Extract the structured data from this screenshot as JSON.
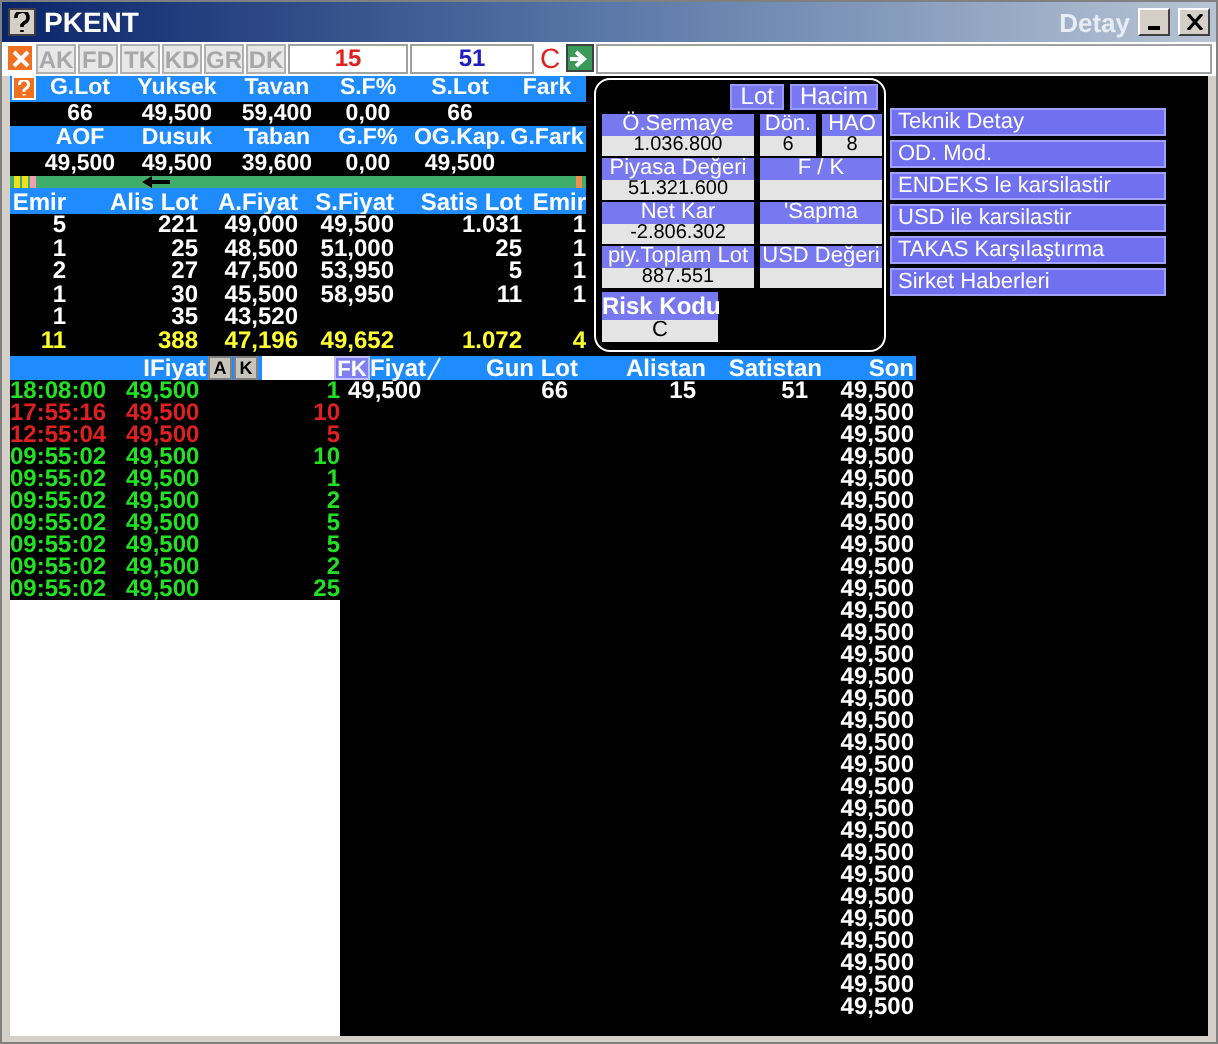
{
  "window": {
    "title": "PKENT",
    "detail_title": "Detay"
  },
  "toolbar": {
    "tabs": [
      "AK",
      "FD",
      "TK",
      "KD",
      "GR",
      "DK"
    ],
    "buy_count": "15",
    "sell_count": "51",
    "risk_letter": "C"
  },
  "summary": [
    {
      "kind": "header",
      "cells": [
        "G.Lot",
        "Yuksek",
        "Tavan",
        "S.F%",
        "S.Lot",
        "Fark"
      ]
    },
    {
      "kind": "values",
      "cells": [
        "66",
        "49,500",
        "59,400",
        "0,00",
        "66",
        ""
      ]
    },
    {
      "kind": "header",
      "cells": [
        "AOF",
        "Dusuk",
        "Taban",
        "G.F%",
        "OG.Kap.",
        "G.Fark"
      ]
    },
    {
      "kind": "values",
      "cells": [
        "49,500",
        "49,500",
        "39,600",
        "0,00",
        "49,500",
        ""
      ]
    }
  ],
  "order_book": {
    "columns": [
      "Emir",
      "Alis Lot",
      "A.Fiyat",
      "S.Fiyat",
      "Satis Lot",
      "Emir"
    ],
    "rows": [
      [
        "5",
        "221",
        "49,000",
        "49,500",
        "1.031",
        "1"
      ],
      [
        "1",
        "25",
        "48,500",
        "51,000",
        "25",
        "1"
      ],
      [
        "2",
        "27",
        "47,500",
        "53,950",
        "5",
        "1"
      ],
      [
        "1",
        "30",
        "45,500",
        "58,950",
        "11",
        "1"
      ],
      [
        "1",
        "35",
        "43,520",
        "",
        "",
        ""
      ]
    ],
    "totals": [
      "11",
      "388",
      "47,196",
      "49,652",
      "1.072",
      "4"
    ]
  },
  "detail": {
    "toggles": [
      "Lot",
      "Hacim"
    ],
    "rows": [
      [
        {
          "label": "Ö.Sermaye",
          "value": "1.036.800"
        },
        {
          "label": "Dön.",
          "value": "6"
        },
        {
          "label": "HAO",
          "value": "8"
        }
      ],
      [
        {
          "label": "Piyasa Değeri",
          "value": "51.321.600"
        },
        {
          "label": "F / K"
        }
      ],
      [
        {
          "label": "Net Kar",
          "value": "-2.806.302"
        },
        {
          "label": "'Sapma"
        }
      ],
      [
        {
          "label": "piy.Toplam Lot",
          "value": "887.551"
        },
        {
          "label": "USD Değeri"
        }
      ]
    ],
    "risk": {
      "label": "Risk Kodu",
      "value": "C"
    }
  },
  "links": [
    "Teknik Detay",
    "OD. Mod.",
    "ENDEKS le karsilastir",
    "USD ile karsilastir",
    "TAKAS Karşılaştırma",
    "Sirket Haberleri"
  ],
  "trades_header": {
    "price_label": "IFiyat",
    "sort_buttons": [
      "A",
      "K"
    ],
    "filter_button": "FK",
    "columns": [
      "Fiyat",
      "Gun Lot",
      "Alistan",
      "Satistan",
      "Son"
    ]
  },
  "trades": [
    {
      "time": "18:08:00",
      "price": "49,500",
      "lot": "1",
      "kind": "up"
    },
    {
      "time": "17:55:16",
      "price": "49,500",
      "lot": "10",
      "kind": "down"
    },
    {
      "time": "12:55:04",
      "price": "49,500",
      "lot": "5",
      "kind": "down"
    },
    {
      "time": "09:55:02",
      "price": "49,500",
      "lot": "10",
      "kind": "up"
    },
    {
      "time": "09:55:02",
      "price": "49,500",
      "lot": "1",
      "kind": "up"
    },
    {
      "time": "09:55:02",
      "price": "49,500",
      "lot": "2",
      "kind": "up"
    },
    {
      "time": "09:55:02",
      "price": "49,500",
      "lot": "5",
      "kind": "up"
    },
    {
      "time": "09:55:02",
      "price": "49,500",
      "lot": "5",
      "kind": "up"
    },
    {
      "time": "09:55:02",
      "price": "49,500",
      "lot": "2",
      "kind": "up"
    },
    {
      "time": "09:55:02",
      "price": "49,500",
      "lot": "25",
      "kind": "up"
    }
  ],
  "quote": {
    "fiyat": "49,500",
    "gun_lot": "66",
    "alistan": "15",
    "satistan": "51"
  },
  "son": [
    "49,500",
    "49,500",
    "49,500",
    "49,500",
    "49,500",
    "49,500",
    "49,500",
    "49,500",
    "49,500",
    "49,500",
    "49,500",
    "49,500",
    "49,500",
    "49,500",
    "49,500",
    "49,500",
    "49,500",
    "49,500",
    "49,500",
    "49,500",
    "49,500",
    "49,500",
    "49,500",
    "49,500",
    "49,500",
    "49,500",
    "49,500",
    "49,500",
    "49,500"
  ]
}
